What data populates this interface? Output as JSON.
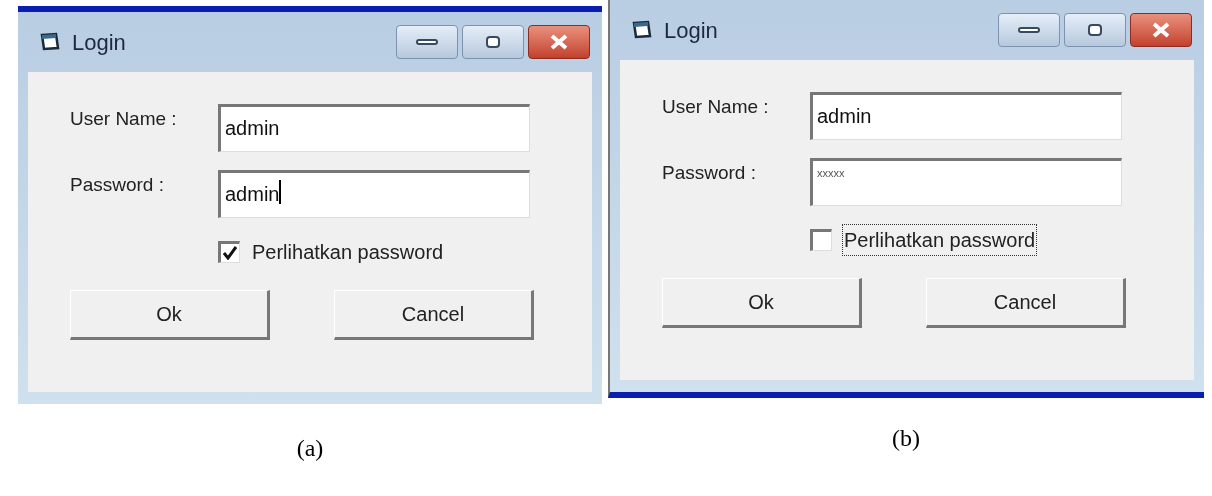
{
  "panels": [
    {
      "window": {
        "title": "Login"
      },
      "fields": [
        {
          "label": "User Name :",
          "value": "admin",
          "kind": "plain"
        },
        {
          "label": "Password :",
          "value": "admin",
          "kind": "caret"
        }
      ],
      "checkbox": {
        "label": "Perlihatkan password",
        "checked": true,
        "focused": false
      },
      "buttons": [
        "Ok",
        "Cancel"
      ],
      "caption": "(a)"
    },
    {
      "window": {
        "title": "Login"
      },
      "fields": [
        {
          "label": "User Name :",
          "value": "admin",
          "kind": "plain"
        },
        {
          "label": "Password :",
          "value": "xxxxx",
          "kind": "masked"
        }
      ],
      "checkbox": {
        "label": "Perlihatkan password",
        "checked": false,
        "focused": true
      },
      "buttons": [
        "Ok",
        "Cancel"
      ],
      "caption": "(b)"
    }
  ]
}
